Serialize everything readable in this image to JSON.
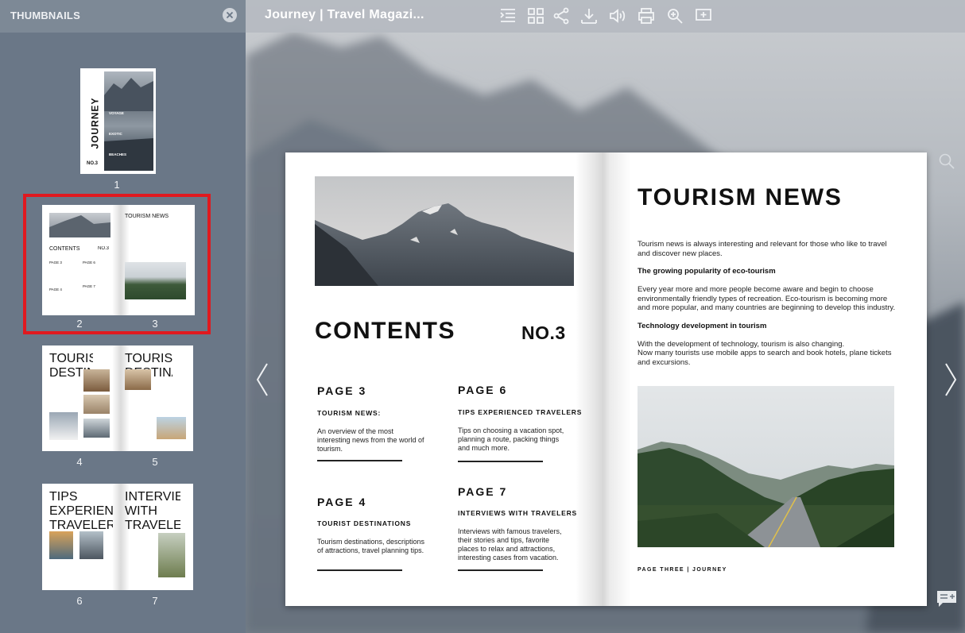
{
  "toolbar": {
    "title": "Journey | Travel Magazi...",
    "icons": [
      "table-of-contents-icon",
      "grid-icon",
      "share-icon",
      "download-icon",
      "sound-icon",
      "print-icon",
      "zoom-icon",
      "add-note-icon"
    ]
  },
  "sidebar": {
    "title": "THUMBNAILS",
    "thumbnails": [
      {
        "pages": [
          "1"
        ]
      },
      {
        "pages": [
          "2",
          "3"
        ],
        "selected": true
      },
      {
        "pages": [
          "4",
          "5"
        ]
      },
      {
        "pages": [
          "6",
          "7"
        ]
      }
    ],
    "thumb_text": {
      "cover_title": "JOURNEY",
      "cover_no": "NO.3",
      "cover_sections": [
        "VOYAGE",
        "EXOTIC",
        "BEACHES"
      ],
      "p45_left": "TOURIST DESTINATIONS",
      "p45_right": "TOURIST DESTINATIONS",
      "p67_left": "TIPS EXPERIENCED TRAVELERS",
      "p67_right": "INTERVIEW WITH TRAVELERS",
      "p23_contents": "CONTENTS",
      "p23_no": "NO.3",
      "p23_news": "TOURISM NEWS",
      "p23_pages": [
        "PAGE 3",
        "PAGE 6",
        "PAGE 4",
        "PAGE 7"
      ]
    }
  },
  "left_page": {
    "contents_title": "CONTENTS",
    "issue_no": "NO.3",
    "entries": [
      {
        "page": "PAGE 3",
        "heading": "TOURISM NEWS:",
        "desc": "An overview of the most interesting news from the world of tourism."
      },
      {
        "page": "PAGE 6",
        "heading": "TIPS EXPERIENCED TRAVELERS",
        "desc": "Tips on choosing a vacation spot, planning a route, packing things and much more."
      },
      {
        "page": "PAGE 4",
        "heading": "TOURIST DESTINATIONS",
        "desc": "Tourism destinations, descriptions of attractions, travel planning tips."
      },
      {
        "page": "PAGE 7",
        "heading": "INTERVIEWS WITH TRAVELERS",
        "desc": "Interviews with famous travelers, their stories and tips, favorite places to relax and attractions, interesting cases from vacation."
      }
    ]
  },
  "right_page": {
    "title": "TOURISM NEWS",
    "intro": "Tourism news is always interesting and relevant for those who like to travel and discover new places.",
    "h1": "The growing popularity of eco-tourism",
    "p1": "Every year more and more people become aware and begin to choose environmentally friendly types of recreation. Eco-tourism is becoming more and more popular, and many countries are beginning to develop this industry.",
    "h2": "Technology development in tourism",
    "p2a": "With the development of technology, tourism is also changing.",
    "p2b": "Now many tourists use mobile apps to search and book hotels, plane tickets and excursions.",
    "footer": "PAGE THREE | JOURNEY"
  },
  "colors": {
    "selection": "#e0191f",
    "sidebar_bg": "#6a7787",
    "toolbar_text": "#ffffff"
  }
}
